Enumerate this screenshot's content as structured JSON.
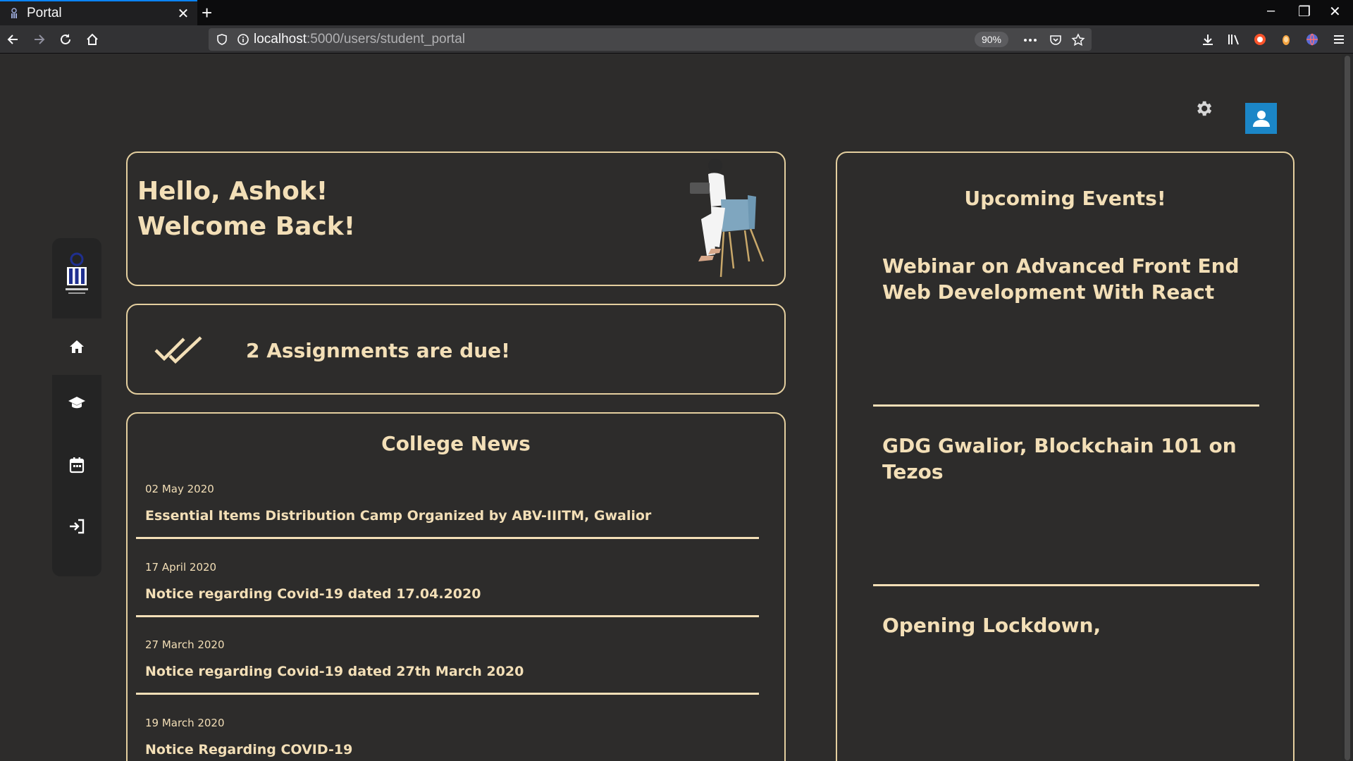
{
  "browser": {
    "tab_title": "Portal",
    "tab_close": "✕",
    "new_tab": "+",
    "url_host": "localhost",
    "url_path": ":5000/users/student_portal",
    "zoom": "90%",
    "window_minimize": "–",
    "window_restore": "❐",
    "window_close": "✕"
  },
  "header": {
    "settings_icon": "gear-icon",
    "avatar_icon": "user-icon",
    "avatar_color": "#1b86c7"
  },
  "sidebar": {
    "items": [
      {
        "name": "logo",
        "icon": "college-logo"
      },
      {
        "name": "home",
        "icon": "home-icon",
        "active": true
      },
      {
        "name": "courses",
        "icon": "graduation-cap-icon"
      },
      {
        "name": "calendar",
        "icon": "calendar-icon"
      },
      {
        "name": "logout",
        "icon": "sign-out-icon"
      }
    ]
  },
  "greeting": {
    "line1": "Hello, Ashok!",
    "line2": "Welcome Back!"
  },
  "assignments": {
    "text": "2 Assignments are due!"
  },
  "news": {
    "title": "College News",
    "items": [
      {
        "date": "02 May 2020",
        "headline": "Essential Items Distribution Camp Organized by ABV-IIITM, Gwalior"
      },
      {
        "date": "17 April 2020",
        "headline": "Notice regarding Covid-19 dated 17.04.2020"
      },
      {
        "date": "27 March 2020",
        "headline": "Notice regarding Covid-19 dated 27th March 2020"
      },
      {
        "date": "19 March 2020",
        "headline": "Notice Regarding COVID-19"
      }
    ]
  },
  "events": {
    "title": "Upcoming Events!",
    "items": [
      {
        "title": "Webinar on Advanced Front End Web Development With React"
      },
      {
        "title": "GDG Gwalior, Blockchain 101 on Tezos"
      },
      {
        "title": "Opening Lockdown,"
      }
    ]
  },
  "colors": {
    "background": "#2d2c2b",
    "accent": "#f3dfb7",
    "border": "#e4cf9f",
    "sidebar": "#242424"
  }
}
